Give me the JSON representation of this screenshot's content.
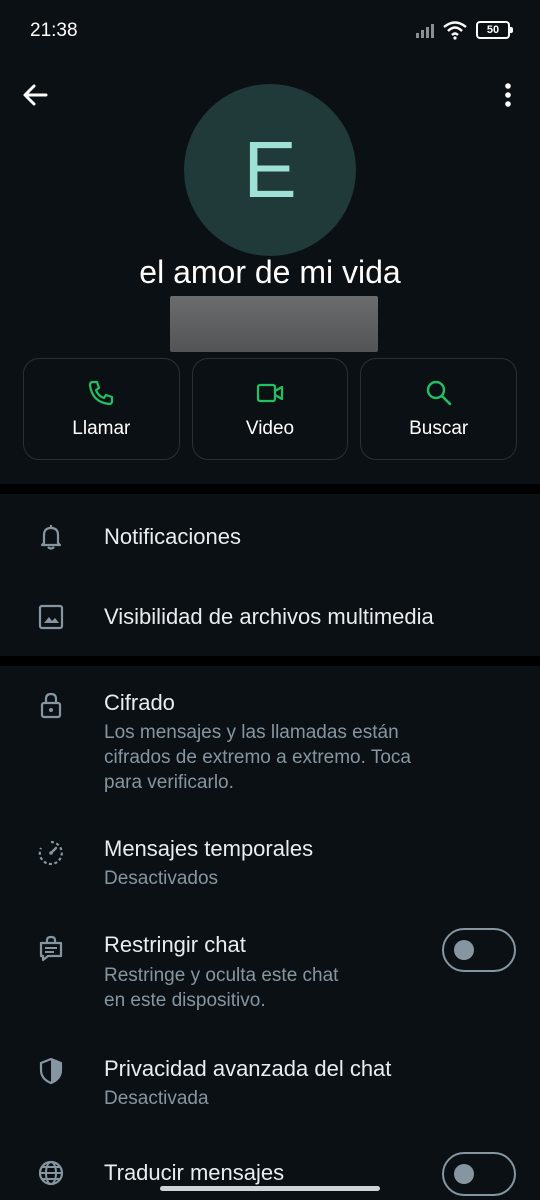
{
  "status": {
    "time": "21:38",
    "battery": "50"
  },
  "contact": {
    "initial": "E",
    "name": "el amor de mi vida"
  },
  "actions": [
    {
      "label": "Llamar",
      "icon": "phone-icon"
    },
    {
      "label": "Video",
      "icon": "video-icon"
    },
    {
      "label": "Buscar",
      "icon": "search-icon"
    }
  ],
  "settings": {
    "notifications": {
      "title": "Notificaciones",
      "icon": "bell-icon"
    },
    "media_visibility": {
      "title": "Visibilidad de archivos multimedia",
      "icon": "image-icon"
    },
    "encryption": {
      "title": "Cifrado",
      "subtitle_line1": "Los mensajes y las llamadas están",
      "subtitle_line2": "cifrados de extremo a extremo. Toca",
      "subtitle_line3": "para verificarlo.",
      "icon": "lock-icon"
    },
    "disappearing": {
      "title": "Mensajes temporales",
      "subtitle": "Desactivados",
      "icon": "timer-icon"
    },
    "restrict": {
      "title": "Restringir chat",
      "subtitle_line1": "Restringe y oculta este chat",
      "subtitle_line2": "en este dispositivo.",
      "toggle_on": false,
      "icon": "chat-lock-icon"
    },
    "advanced_privacy": {
      "title": "Privacidad avanzada del chat",
      "subtitle": "Desactivada",
      "icon": "shield-icon"
    },
    "translate": {
      "title": "Traducir mensajes",
      "toggle_on": false,
      "icon": "globe-icon"
    }
  },
  "colors": {
    "background": "#0b1014",
    "accent": "#21c063",
    "secondary_text": "#8696a0"
  }
}
